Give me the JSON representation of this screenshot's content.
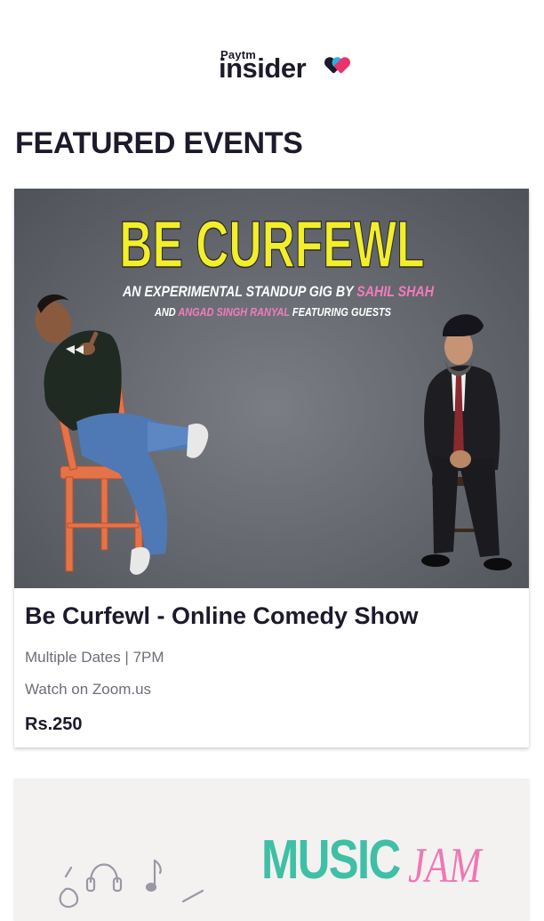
{
  "header": {
    "logo": {
      "brand_small": "Paytm",
      "brand_main": "insider",
      "icon": "insider-hearts-logo-icon"
    }
  },
  "section": {
    "title": "FEATURED EVENTS"
  },
  "featured_events": [
    {
      "banner": {
        "headline": "BE CURFEWL",
        "line1_prefix": "AN EXPERIMENTAL STANDUP GIG BY ",
        "line1_highlight": "SAHIL SHAH",
        "line2_prefix": "AND ",
        "line2_highlight": "ANGAD SINGH RANYAL",
        "line2_suffix": " FEATURING GUESTS"
      },
      "title": "Be Curfewl - Online Comedy Show",
      "dates": "Multiple Dates | 7PM",
      "venue": "Watch on Zoom.us",
      "price": "Rs.250"
    },
    {
      "banner": {
        "word1": "MUSIC",
        "word2": "JAM"
      }
    }
  ],
  "colors": {
    "brand_dark": "#1c1a2b",
    "brand_pink": "#e8336c",
    "brand_blue": "#2ab0e5",
    "headline_yellow": "#f2ee2b",
    "highlight_pink": "#f27bbf",
    "music_teal": "#3fbfa6",
    "jam_pink": "#f077b6"
  }
}
